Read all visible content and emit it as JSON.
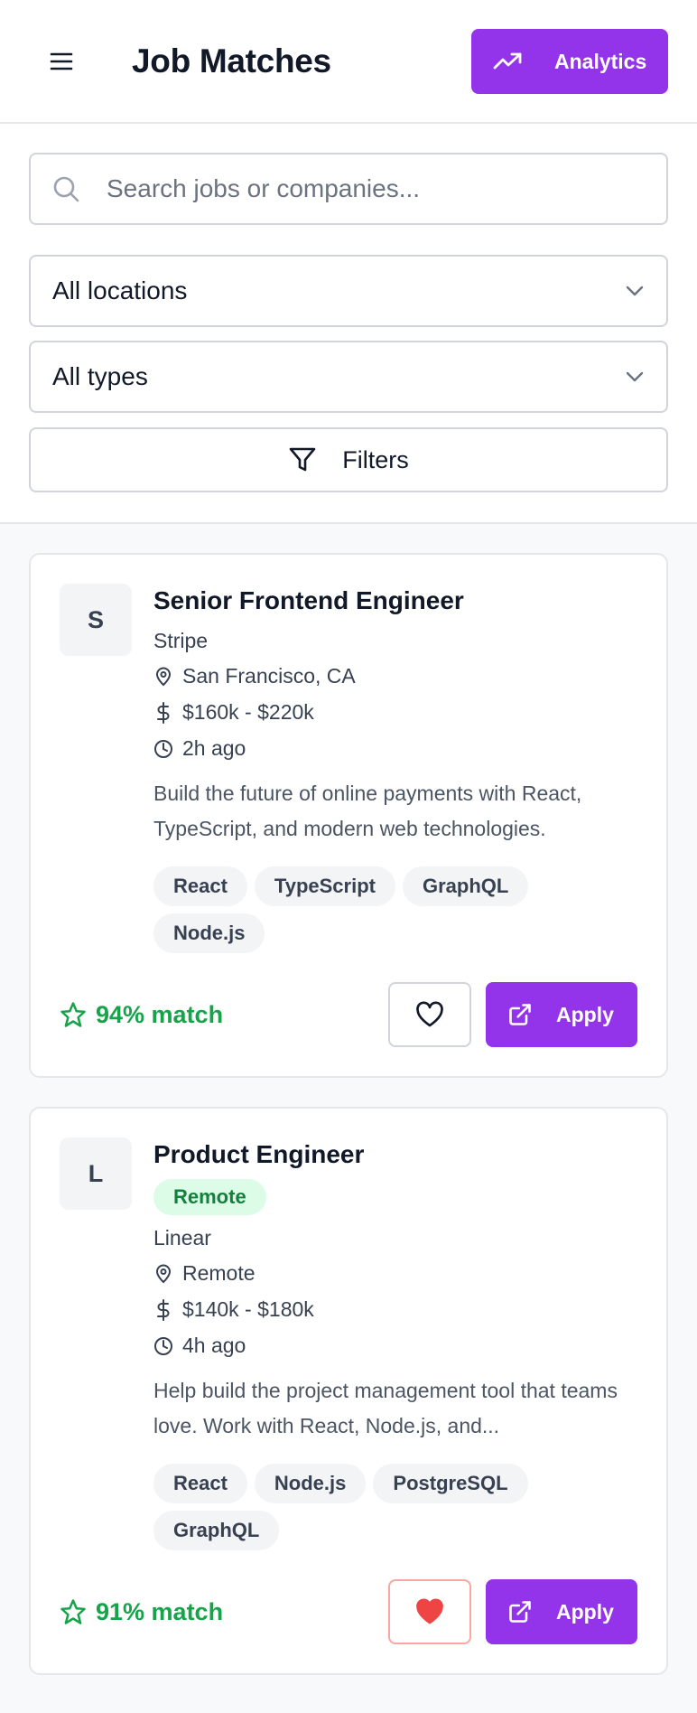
{
  "header": {
    "title": "Job Matches",
    "analytics_label": "Analytics"
  },
  "search": {
    "placeholder": "Search jobs or companies..."
  },
  "filters": {
    "location_selected": "All locations",
    "type_selected": "All types",
    "filters_label": "Filters"
  },
  "colors": {
    "accent": "#9333ea",
    "match_green": "#16a34a",
    "saved_red": "#ef4444"
  },
  "jobs": [
    {
      "avatar_letter": "S",
      "title": "Senior Frontend Engineer",
      "badge": "",
      "company": "Stripe",
      "location": "San Francisco, CA",
      "salary": "$160k - $220k",
      "posted": "2h ago",
      "description": "Build the future of online payments with React, TypeScript, and modern web technologies.",
      "tags": [
        "React",
        "TypeScript",
        "GraphQL",
        "Node.js"
      ],
      "match": "94% match",
      "saved": false,
      "apply_label": "Apply"
    },
    {
      "avatar_letter": "L",
      "title": "Product Engineer",
      "badge": "Remote",
      "company": "Linear",
      "location": "Remote",
      "salary": "$140k - $180k",
      "posted": "4h ago",
      "description": "Help build the project management tool that teams love. Work with React, Node.js, and...",
      "tags": [
        "React",
        "Node.js",
        "PostgreSQL",
        "GraphQL"
      ],
      "match": "91% match",
      "saved": true,
      "apply_label": "Apply"
    }
  ]
}
